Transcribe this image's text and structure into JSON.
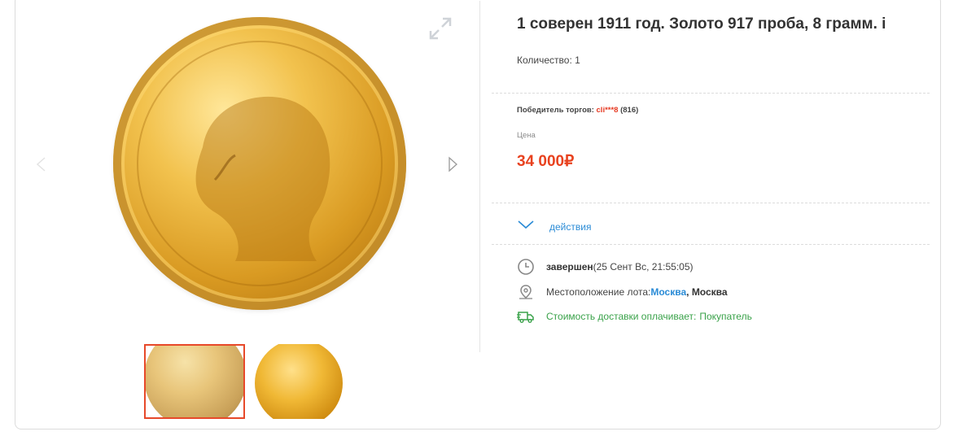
{
  "product": {
    "title": "1 соверен 1911 год. Золото 917 проба, 8 грамм. i",
    "quantity_label": "Количество:",
    "quantity_value": "1"
  },
  "gallery": {
    "main_image_alt": "coin-obverse",
    "thumbnails": [
      "thumb-obverse",
      "thumb-reverse"
    ],
    "active_thumbnail": 0
  },
  "auction": {
    "winner_label": "Победитель торгов:",
    "winner_name": "cli***8",
    "winner_rating": "(816)",
    "price_label": "Цена",
    "price_value": "34 000₽",
    "actions_label": "действия"
  },
  "details": {
    "status_bold": "завершен",
    "status_rest": "(25 Сент Вс, 21:55:05)",
    "location_label": "Местоположение лота:",
    "location_city": "Москва",
    "location_sep": ", ",
    "location_region": "Москва",
    "delivery_label": "Стоимость доставки оплачивает:",
    "delivery_value": "Покупатель"
  },
  "colors": {
    "accent_red": "#e8421f",
    "link_blue": "#2a8bd6",
    "delivery_green": "#3aa24a",
    "active_thumb_border": "#e7492a"
  },
  "icons": [
    "expand-icon",
    "chevron-left-icon",
    "chevron-right-icon",
    "chevron-down-icon",
    "clock-icon",
    "map-pin-icon",
    "truck-icon"
  ]
}
